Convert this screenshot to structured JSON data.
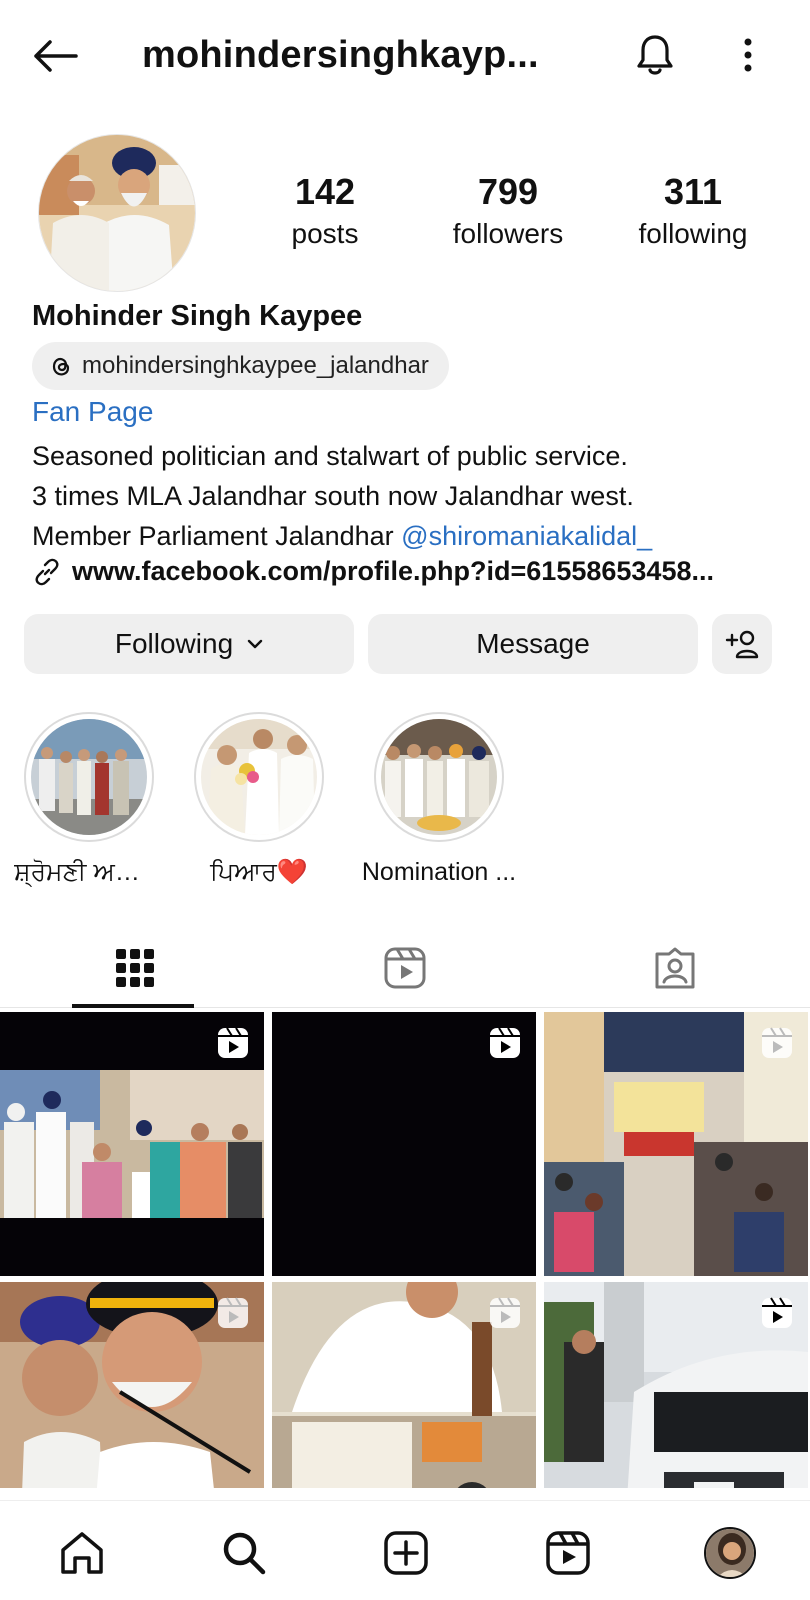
{
  "header": {
    "title": "mohindersinghkayp...",
    "back_icon": "arrow-left-icon",
    "bell_icon": "bell-icon",
    "more_icon": "more-vertical-icon"
  },
  "profile": {
    "stats": [
      {
        "value": "142",
        "label": "posts"
      },
      {
        "value": "799",
        "label": "followers"
      },
      {
        "value": "311",
        "label": "following"
      }
    ],
    "name": "Mohinder Singh Kaypee",
    "threads_handle": "mohindersinghkaypee_jalandhar",
    "category": "Fan Page",
    "bio_line1": "Seasoned politician and stalwart of public service.",
    "bio_line2": "3 times MLA Jalandhar south now Jalandhar west.",
    "bio_line3_text": "Member Parliament Jalandhar ",
    "bio_line3_mention": "@shiromaniakalidal_",
    "link": "www.facebook.com/profile.php?id=61558653458..."
  },
  "actions": {
    "following_label": "Following",
    "message_label": "Message",
    "add_user_icon": "add-user-icon"
  },
  "highlights": [
    {
      "caption": "ਸ਼੍ਰੋਮਣੀ ਅਕਾਲੀ ਦ"
    },
    {
      "caption": "ਪਿਆਰ❤️"
    },
    {
      "caption": "Nomination ..."
    }
  ],
  "tabs": [
    {
      "name": "posts-grid",
      "icon": "grid-icon",
      "active": true
    },
    {
      "name": "reels",
      "icon": "reels-icon",
      "active": false
    },
    {
      "name": "tagged",
      "icon": "tagged-icon",
      "active": false
    }
  ],
  "bottom_nav": [
    {
      "name": "home",
      "icon": "home-icon"
    },
    {
      "name": "search",
      "icon": "search-icon"
    },
    {
      "name": "create",
      "icon": "plus-square-icon"
    },
    {
      "name": "reels",
      "icon": "reels-icon"
    },
    {
      "name": "profile",
      "icon": "profile-avatar"
    }
  ],
  "colors": {
    "link_blue": "#2a6fc2",
    "button_bg": "#efefef",
    "text": "#111111"
  }
}
